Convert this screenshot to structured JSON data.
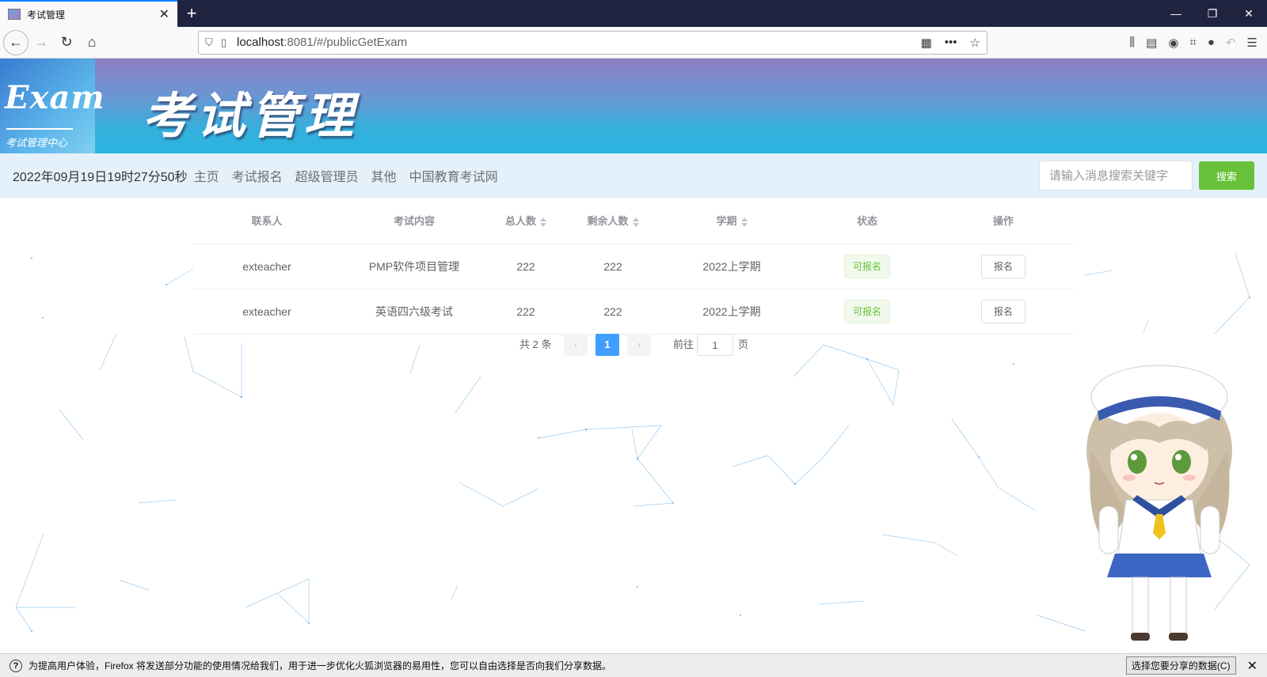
{
  "browser": {
    "tab_title": "考试管理",
    "url_host": "localhost",
    "url_rest": ":8081/#/publicGetExam",
    "notification_text": "为提高用户体验，Firefox 将发送部分功能的使用情况给我们，用于进一步优化火狐浏览器的易用性，您可以自由选择是否向我们分享数据。",
    "notification_button": "选择您要分享的数据(C)"
  },
  "banner": {
    "logo_text": "Exam",
    "logo_subtext": "考试管理中心",
    "title": "考试管理"
  },
  "topnav": {
    "datetime": "2022年09月19日19时27分50秒",
    "links": [
      "主页",
      "考试报名",
      "超级管理员",
      "其他",
      "中国教育考试网"
    ],
    "search_placeholder": "请输入消息搜索关键字",
    "search_button": "搜索"
  },
  "table": {
    "headers": [
      "联系人",
      "考试内容",
      "总人数",
      "剩余人数",
      "学期",
      "状态",
      "操作"
    ],
    "rows": [
      {
        "contact": "exteacher",
        "content": "PMP软件项目管理",
        "total": "222",
        "remaining": "222",
        "term": "2022上学期",
        "status": "可报名",
        "action": "报名"
      },
      {
        "contact": "exteacher",
        "content": "英语四六级考试",
        "total": "222",
        "remaining": "222",
        "term": "2022上学期",
        "status": "可报名",
        "action": "报名"
      }
    ]
  },
  "pagination": {
    "total_text": "共 2 条",
    "current_page": "1",
    "goto_label": "前往",
    "goto_value": "1",
    "page_suffix": "页",
    "prev_icon": "chevron-left-icon",
    "next_icon": "chevron-right-icon"
  },
  "colors": {
    "accent_green": "#67c23a",
    "accent_blue": "#409eff",
    "nav_bg": "#e4f1fb"
  }
}
